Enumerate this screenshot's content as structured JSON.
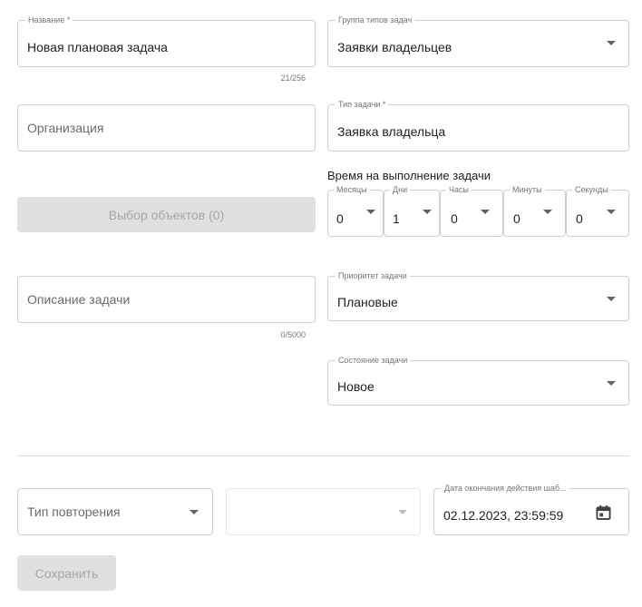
{
  "form": {
    "name": {
      "label": "Название *",
      "value": "Новая плановая задача",
      "counter": "21/256"
    },
    "task_type_group": {
      "label": "Группа типов задач",
      "value": "Заявки владельцев"
    },
    "organization": {
      "placeholder": "Организация"
    },
    "task_type": {
      "label": "Тип задачи *",
      "value": "Заявка владельца"
    },
    "duration": {
      "title": "Время на выполнение задачи",
      "months": {
        "label": "Месяцы",
        "value": "0"
      },
      "days": {
        "label": "Дни",
        "value": "1"
      },
      "hours": {
        "label": "Часы",
        "value": "0"
      },
      "minutes": {
        "label": "Минуты",
        "value": "0"
      },
      "seconds": {
        "label": "Секунды",
        "value": "0"
      }
    },
    "select_objects_button": "Выбор объектов (0)",
    "description": {
      "placeholder": "Описание задачи",
      "counter": "0/5000"
    },
    "priority": {
      "label": "Приоритет задачи",
      "value": "Плановые"
    },
    "state": {
      "label": "Состояние задачи",
      "value": "Новое"
    },
    "repeat_type": {
      "placeholder": "Тип повторения"
    },
    "end_date": {
      "label": "Дата окончания действия шаб...",
      "value": "02.12.2023, 23:59:59"
    },
    "save_button": "Сохранить"
  },
  "icons": {
    "dropdown": "chevron-down-icon",
    "calendar": "calendar-icon"
  },
  "colors": {
    "border": "#cfcfcf",
    "disabled_bg": "#e0e0e0",
    "disabled_text": "#a6a6a6"
  }
}
